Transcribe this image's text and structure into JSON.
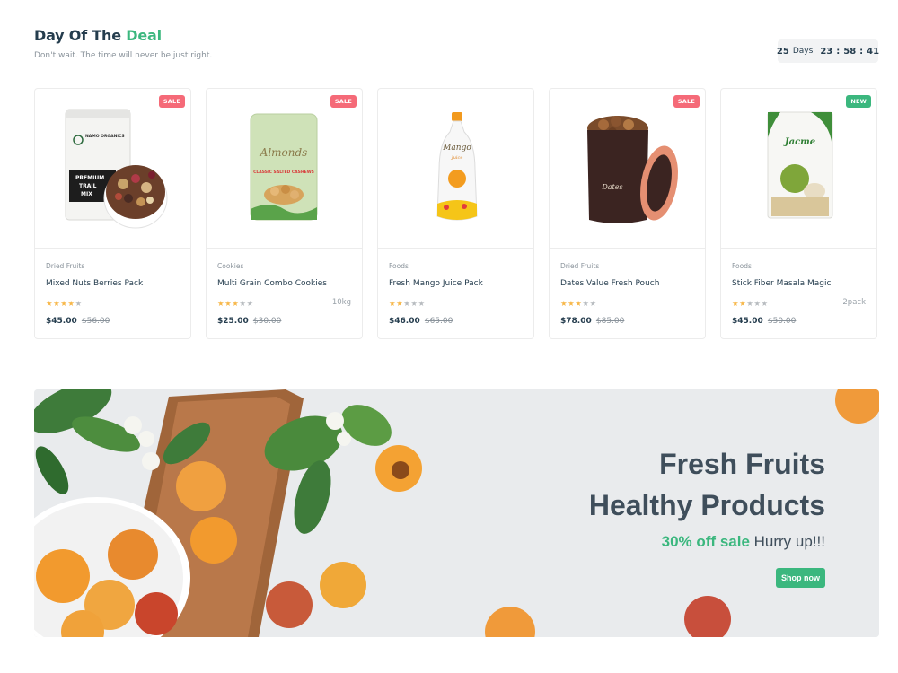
{
  "section": {
    "title_main": "Day Of The ",
    "title_accent": "Deal",
    "subtitle": "Don't wait. The time will never be just right."
  },
  "countdown": {
    "days": "25",
    "days_label": "Days",
    "hours": "23",
    "minutes": "58",
    "seconds": "41",
    "separator": ":"
  },
  "products": [
    {
      "badge": "SALE",
      "badge_type": "sale",
      "category": "Dried Fruits",
      "name": "Mixed Nuts Berries Pack",
      "rating": 4,
      "weight": "",
      "price": "$45.00",
      "old_price": "$56.00",
      "image_icon": "trail-mix-pouch-icon"
    },
    {
      "badge": "SALE",
      "badge_type": "sale",
      "category": "Cookies",
      "name": "Multi Grain Combo Cookies",
      "rating": 3,
      "weight": "10kg",
      "price": "$25.00",
      "old_price": "$30.00",
      "image_icon": "almonds-pouch-icon"
    },
    {
      "badge": "",
      "badge_type": "",
      "category": "Foods",
      "name": "Fresh Mango Juice Pack",
      "rating": 2,
      "weight": "",
      "price": "$46.00",
      "old_price": "$65.00",
      "image_icon": "mango-juice-pack-icon"
    },
    {
      "badge": "SALE",
      "badge_type": "sale",
      "category": "Dried Fruits",
      "name": "Dates Value Fresh Pouch",
      "rating": 3,
      "weight": "",
      "price": "$78.00",
      "old_price": "$85.00",
      "image_icon": "dates-tin-icon"
    },
    {
      "badge": "NEW",
      "badge_type": "new",
      "category": "Foods",
      "name": "Stick Fiber Masala Magic",
      "rating": 2,
      "weight": "2pack",
      "price": "$45.00",
      "old_price": "$50.00",
      "image_icon": "masala-pouch-icon"
    }
  ],
  "product_images": {
    "trail_mix": {
      "brand": "NAMO ORGANICS",
      "label1": "PREMIUM",
      "label2": "TRAIL",
      "label3": "MIX"
    },
    "almonds": {
      "script": "Almonds",
      "sub": "CLASSIC SALTED CASHEWS"
    },
    "mango": {
      "script": "Mango",
      "sub": "Juice"
    },
    "dates": {
      "script": "Dates"
    },
    "masala": {
      "script": "Jacme"
    }
  },
  "banner": {
    "line1": "Fresh Fruits",
    "line2": "Healthy Products",
    "offer_highlight": "30% off sale",
    "offer_rest": " Hurry up!!!",
    "cta": "Shop now"
  },
  "colors": {
    "accent": "#3bb77e",
    "sale_badge": "#f56a78",
    "star_on": "#f7b84b",
    "heading": "#253d4e"
  }
}
